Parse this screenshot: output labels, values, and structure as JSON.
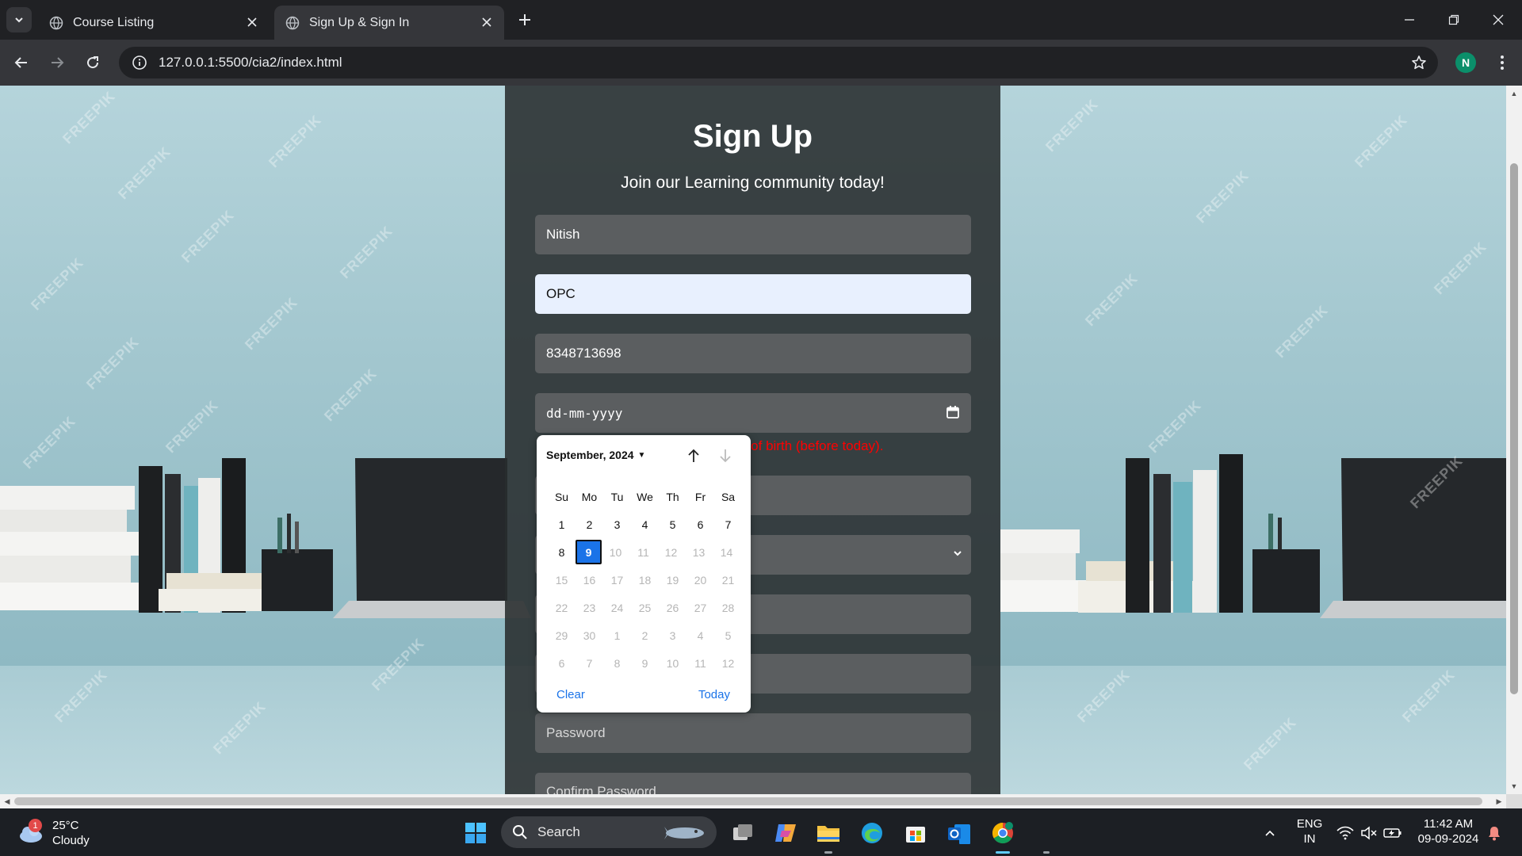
{
  "browser": {
    "tabs": [
      {
        "title": "Course Listing",
        "active": false
      },
      {
        "title": "Sign Up & Sign In",
        "active": true
      }
    ],
    "url": "127.0.0.1:5500/cia2/index.html",
    "profile_initial": "N"
  },
  "page": {
    "watermark": "FREEPIK",
    "title": "Sign Up",
    "subtitle": "Join our Learning community today!",
    "fields": {
      "first_name": "Nitish",
      "last_name": "OPC",
      "phone": "8348713698",
      "dob_placeholder": "dd-mm-yyyy",
      "password_placeholder": "Password",
      "confirm_password_placeholder": "Confirm Password"
    },
    "error_visible": "e of birth (before today)."
  },
  "datepicker": {
    "month_label": "September, 2024",
    "weekdays": [
      "Su",
      "Mo",
      "Tu",
      "We",
      "Th",
      "Fr",
      "Sa"
    ],
    "weeks": [
      [
        {
          "d": "1"
        },
        {
          "d": "2"
        },
        {
          "d": "3"
        },
        {
          "d": "4"
        },
        {
          "d": "5"
        },
        {
          "d": "6"
        },
        {
          "d": "7"
        }
      ],
      [
        {
          "d": "8"
        },
        {
          "d": "9",
          "selected": true
        },
        {
          "d": "10",
          "dim": true
        },
        {
          "d": "11",
          "dim": true
        },
        {
          "d": "12",
          "dim": true
        },
        {
          "d": "13",
          "dim": true
        },
        {
          "d": "14",
          "dim": true
        }
      ],
      [
        {
          "d": "15",
          "dim": true
        },
        {
          "d": "16",
          "dim": true
        },
        {
          "d": "17",
          "dim": true
        },
        {
          "d": "18",
          "dim": true
        },
        {
          "d": "19",
          "dim": true
        },
        {
          "d": "20",
          "dim": true
        },
        {
          "d": "21",
          "dim": true
        }
      ],
      [
        {
          "d": "22",
          "dim": true
        },
        {
          "d": "23",
          "dim": true
        },
        {
          "d": "24",
          "dim": true
        },
        {
          "d": "25",
          "dim": true
        },
        {
          "d": "26",
          "dim": true
        },
        {
          "d": "27",
          "dim": true
        },
        {
          "d": "28",
          "dim": true
        }
      ],
      [
        {
          "d": "29",
          "dim": true
        },
        {
          "d": "30",
          "dim": true
        },
        {
          "d": "1",
          "dim": true
        },
        {
          "d": "2",
          "dim": true
        },
        {
          "d": "3",
          "dim": true
        },
        {
          "d": "4",
          "dim": true
        },
        {
          "d": "5",
          "dim": true
        }
      ],
      [
        {
          "d": "6",
          "dim": true
        },
        {
          "d": "7",
          "dim": true
        },
        {
          "d": "8",
          "dim": true
        },
        {
          "d": "9",
          "dim": true
        },
        {
          "d": "10",
          "dim": true
        },
        {
          "d": "11",
          "dim": true
        },
        {
          "d": "12",
          "dim": true
        }
      ]
    ],
    "clear_label": "Clear",
    "today_label": "Today"
  },
  "taskbar": {
    "weather_temp": "25°C",
    "weather_desc": "Cloudy",
    "weather_badge": "1",
    "search_label": "Search",
    "lang_top": "ENG",
    "lang_bottom": "IN",
    "time": "11:42 AM",
    "date": "09-09-2024"
  },
  "colors": {
    "accent": "#1a73e8",
    "error": "#ff0000",
    "card": "#2a2e30"
  }
}
